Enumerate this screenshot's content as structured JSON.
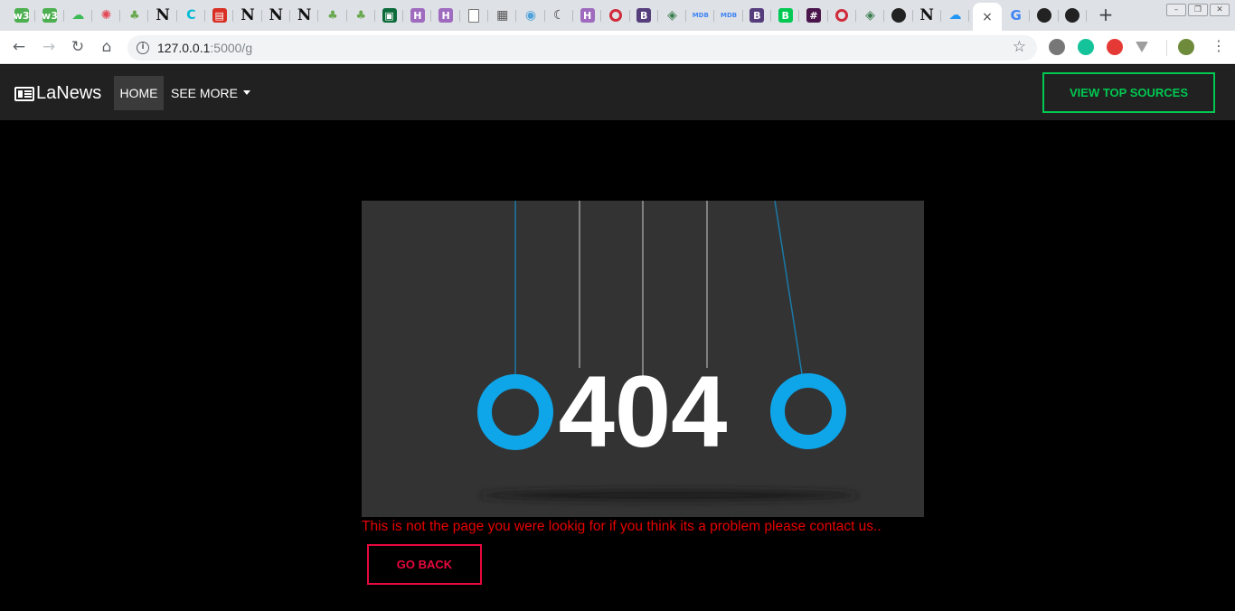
{
  "browser": {
    "url_host": "127.0.0.1",
    "url_path": ":5000/g",
    "tabs": [
      {
        "icon": "w3schools-icon",
        "glyph": "w3",
        "color": "#4caf50"
      },
      {
        "icon": "w3schools-icon",
        "glyph": "w3",
        "color": "#4caf50"
      },
      {
        "icon": "cloud-icon",
        "glyph": "☁",
        "color": "#3cba54"
      },
      {
        "icon": "openai-icon",
        "glyph": "✺",
        "color": "#e24a55"
      },
      {
        "icon": "plant-icon",
        "glyph": "♣",
        "color": "#69a84f"
      },
      {
        "icon": "notion-icon",
        "glyph": "N",
        "color": "#111111"
      },
      {
        "icon": "codepen-icon",
        "glyph": "C",
        "color": "#00bcd4"
      },
      {
        "icon": "calendar-icon",
        "glyph": "▤",
        "color": "#d93025"
      },
      {
        "icon": "notion-icon",
        "glyph": "N",
        "color": "#111111"
      },
      {
        "icon": "notion-icon",
        "glyph": "N",
        "color": "#111111"
      },
      {
        "icon": "notion-icon",
        "glyph": "N",
        "color": "#111111"
      },
      {
        "icon": "plant-icon",
        "glyph": "♣",
        "color": "#69a84f"
      },
      {
        "icon": "plant-icon",
        "glyph": "♣",
        "color": "#69a84f"
      },
      {
        "icon": "terminal-icon",
        "glyph": "▣",
        "color": "#0b6b3a"
      },
      {
        "icon": "hackerrank-icon",
        "glyph": "H",
        "color": "#9e6bbf"
      },
      {
        "icon": "hackerrank-icon",
        "glyph": "H",
        "color": "#9e6bbf"
      },
      {
        "icon": "document-icon",
        "glyph": "",
        "color": "#ffffff"
      },
      {
        "icon": "book-icon",
        "glyph": "▦",
        "color": "#555555"
      },
      {
        "icon": "eye-icon",
        "glyph": "◉",
        "color": "#4fa3d9"
      },
      {
        "icon": "moon-icon",
        "glyph": "☾",
        "color": "#333333"
      },
      {
        "icon": "hackerrank-icon",
        "glyph": "H",
        "color": "#9e6bbf"
      },
      {
        "icon": "ring-icon",
        "glyph": "",
        "color": "#d12a3b"
      },
      {
        "icon": "bootstrap-icon",
        "glyph": "B",
        "color": "#563d7c"
      },
      {
        "icon": "diamond-icon",
        "glyph": "◈",
        "color": "#3b7d4f"
      },
      {
        "icon": "mdb-icon",
        "glyph": "MDB",
        "color": "#4285f4"
      },
      {
        "icon": "mdb-icon",
        "glyph": "MDB",
        "color": "#4285f4"
      },
      {
        "icon": "bootstrap-icon",
        "glyph": "B",
        "color": "#563d7c"
      },
      {
        "icon": "green-b-icon",
        "glyph": "B",
        "color": "#00c853"
      },
      {
        "icon": "slack-icon",
        "glyph": "#",
        "color": "#4a154b"
      },
      {
        "icon": "ring-icon",
        "glyph": "",
        "color": "#d12a3b"
      },
      {
        "icon": "diamond-icon",
        "glyph": "◈",
        "color": "#3b7d4f"
      },
      {
        "icon": "github-icon",
        "glyph": "●",
        "color": "#222222"
      },
      {
        "icon": "notion-icon",
        "glyph": "N",
        "color": "#111111"
      },
      {
        "icon": "cloud-upload-icon",
        "glyph": "☁",
        "color": "#2196f3"
      }
    ],
    "right_tabs": [
      {
        "icon": "google-icon",
        "glyph": "G",
        "color": "#4285f4"
      },
      {
        "icon": "github-icon",
        "glyph": "●",
        "color": "#222222"
      },
      {
        "icon": "github-icon",
        "glyph": "●",
        "color": "#222222"
      }
    ],
    "active_tab_close": "×",
    "new_tab": "+",
    "extensions": [
      {
        "icon": "extension-icon",
        "color": "#777777"
      },
      {
        "icon": "grammarly-icon",
        "color": "#15c39a"
      },
      {
        "icon": "infinity-icon",
        "color": "#e53935"
      },
      {
        "icon": "vimium-icon",
        "color": "#9e9e9e"
      },
      {
        "icon": "profile-avatar-icon",
        "color": "#6d8b3a"
      }
    ]
  },
  "site": {
    "brand": "LaNews",
    "nav_home": "HOME",
    "nav_more": "SEE MORE",
    "top_sources_button": "VIEW TOP SOURCES",
    "illustration_text": "404",
    "message": "This is not the page you were lookig for if you think its a problem please contact us..",
    "back_button": "GO BACK",
    "colors": {
      "accent_green": "#00c851",
      "error_red": "#e60000",
      "back_red": "#e8093e",
      "ball_blue": "#0ea5e9",
      "navbar_bg": "#212121"
    }
  }
}
